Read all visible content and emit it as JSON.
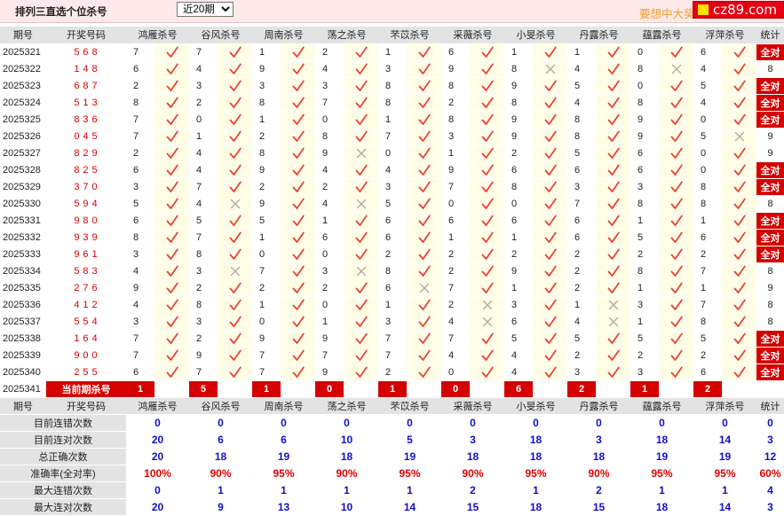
{
  "header": {
    "title": "排列三直选个位杀号",
    "period_select": "近20期",
    "slogan": "要想中大奖",
    "logo_text": "cz89.com"
  },
  "columns": {
    "period": "期号",
    "draw": "开奖号码",
    "experts": [
      "鸿雁杀号",
      "谷风杀号",
      "周南杀号",
      "荡之杀号",
      "芣苡杀号",
      "采薇杀号",
      "小旻杀号",
      "丹露杀号",
      "蕴露杀号",
      "浮萍杀号"
    ],
    "stat": "统计"
  },
  "rows": [
    {
      "period": "2025321",
      "draw": "568",
      "kills": [
        7,
        7,
        1,
        2,
        1,
        6,
        1,
        1,
        0,
        6
      ],
      "hits": [
        1,
        1,
        1,
        1,
        1,
        1,
        1,
        1,
        1,
        1
      ],
      "stat": "全对"
    },
    {
      "period": "2025322",
      "draw": "148",
      "kills": [
        6,
        4,
        9,
        4,
        3,
        9,
        8,
        4,
        8,
        4
      ],
      "hits": [
        1,
        1,
        1,
        1,
        1,
        1,
        0,
        1,
        0,
        1
      ],
      "stat": "8"
    },
    {
      "period": "2025323",
      "draw": "687",
      "kills": [
        2,
        3,
        3,
        3,
        8,
        8,
        9,
        5,
        0,
        5
      ],
      "hits": [
        1,
        1,
        1,
        1,
        1,
        1,
        1,
        1,
        1,
        1
      ],
      "stat": "全对"
    },
    {
      "period": "2025324",
      "draw": "513",
      "kills": [
        8,
        2,
        8,
        7,
        8,
        2,
        8,
        4,
        8,
        4
      ],
      "hits": [
        1,
        1,
        1,
        1,
        1,
        1,
        1,
        1,
        1,
        1
      ],
      "stat": "全对"
    },
    {
      "period": "2025325",
      "draw": "836",
      "kills": [
        7,
        0,
        1,
        0,
        1,
        8,
        9,
        8,
        9,
        0
      ],
      "hits": [
        1,
        1,
        1,
        1,
        1,
        1,
        1,
        1,
        1,
        1
      ],
      "stat": "全对"
    },
    {
      "period": "2025326",
      "draw": "045",
      "kills": [
        7,
        1,
        2,
        8,
        7,
        3,
        9,
        8,
        9,
        5
      ],
      "hits": [
        1,
        1,
        1,
        1,
        1,
        1,
        1,
        1,
        1,
        0
      ],
      "stat": "9"
    },
    {
      "period": "2025327",
      "draw": "829",
      "kills": [
        2,
        4,
        8,
        9,
        0,
        1,
        2,
        5,
        6,
        0
      ],
      "hits": [
        1,
        1,
        1,
        0,
        1,
        1,
        1,
        1,
        1,
        1
      ],
      "stat": "9"
    },
    {
      "period": "2025328",
      "draw": "825",
      "kills": [
        6,
        4,
        9,
        4,
        4,
        9,
        6,
        6,
        6,
        0
      ],
      "hits": [
        1,
        1,
        1,
        1,
        1,
        1,
        1,
        1,
        1,
        1
      ],
      "stat": "全对"
    },
    {
      "period": "2025329",
      "draw": "370",
      "kills": [
        3,
        7,
        2,
        2,
        3,
        7,
        8,
        3,
        3,
        8
      ],
      "hits": [
        1,
        1,
        1,
        1,
        1,
        1,
        1,
        1,
        1,
        1
      ],
      "stat": "全对"
    },
    {
      "period": "2025330",
      "draw": "594",
      "kills": [
        5,
        4,
        9,
        4,
        5,
        0,
        0,
        7,
        8,
        8
      ],
      "hits": [
        1,
        0,
        1,
        0,
        1,
        1,
        1,
        1,
        1,
        1
      ],
      "stat": "8"
    },
    {
      "period": "2025331",
      "draw": "980",
      "kills": [
        6,
        5,
        5,
        1,
        6,
        6,
        6,
        6,
        1,
        1
      ],
      "hits": [
        1,
        1,
        1,
        1,
        1,
        1,
        1,
        1,
        1,
        1
      ],
      "stat": "全对"
    },
    {
      "period": "2025332",
      "draw": "939",
      "kills": [
        8,
        7,
        1,
        6,
        6,
        1,
        1,
        6,
        5,
        6
      ],
      "hits": [
        1,
        1,
        1,
        1,
        1,
        1,
        1,
        1,
        1,
        1
      ],
      "stat": "全对"
    },
    {
      "period": "2025333",
      "draw": "961",
      "kills": [
        3,
        8,
        0,
        0,
        2,
        2,
        2,
        2,
        2,
        2
      ],
      "hits": [
        1,
        1,
        1,
        1,
        1,
        1,
        1,
        1,
        1,
        1
      ],
      "stat": "全对"
    },
    {
      "period": "2025334",
      "draw": "583",
      "kills": [
        4,
        3,
        7,
        3,
        8,
        2,
        9,
        2,
        8,
        7
      ],
      "hits": [
        1,
        0,
        1,
        0,
        1,
        1,
        1,
        1,
        1,
        1
      ],
      "stat": "8"
    },
    {
      "period": "2025335",
      "draw": "276",
      "kills": [
        9,
        2,
        2,
        2,
        6,
        7,
        1,
        2,
        1,
        1
      ],
      "hits": [
        1,
        1,
        1,
        1,
        0,
        1,
        1,
        1,
        1,
        1
      ],
      "stat": "9"
    },
    {
      "period": "2025336",
      "draw": "412",
      "kills": [
        4,
        8,
        1,
        0,
        1,
        2,
        3,
        1,
        3,
        7
      ],
      "hits": [
        1,
        1,
        1,
        1,
        1,
        0,
        1,
        0,
        1,
        1
      ],
      "stat": "8"
    },
    {
      "period": "2025337",
      "draw": "554",
      "kills": [
        3,
        3,
        0,
        1,
        3,
        4,
        6,
        4,
        1,
        8
      ],
      "hits": [
        1,
        1,
        1,
        1,
        1,
        0,
        1,
        0,
        1,
        1
      ],
      "stat": "8"
    },
    {
      "period": "2025338",
      "draw": "164",
      "kills": [
        7,
        2,
        9,
        9,
        7,
        7,
        5,
        5,
        5,
        5
      ],
      "hits": [
        1,
        1,
        1,
        1,
        1,
        1,
        1,
        1,
        1,
        1
      ],
      "stat": "全对"
    },
    {
      "period": "2025339",
      "draw": "900",
      "kills": [
        7,
        9,
        7,
        7,
        7,
        4,
        4,
        2,
        2,
        2
      ],
      "hits": [
        1,
        1,
        1,
        1,
        1,
        1,
        1,
        1,
        1,
        1
      ],
      "stat": "全对"
    },
    {
      "period": "2025340",
      "draw": "255",
      "kills": [
        6,
        7,
        7,
        9,
        2,
        0,
        4,
        3,
        3,
        6
      ],
      "hits": [
        1,
        1,
        1,
        1,
        1,
        1,
        1,
        1,
        1,
        1
      ],
      "stat": "全对"
    }
  ],
  "current": {
    "period": "2025341",
    "label": "当前期杀号",
    "kills": [
      "1",
      "5",
      "1",
      "0",
      "1",
      "0",
      "6",
      "2",
      "1",
      "2"
    ]
  },
  "summary": [
    {
      "label": "目前连错次数",
      "values": [
        "0",
        "0",
        "0",
        "0",
        "0",
        "0",
        "0",
        "0",
        "0",
        "0"
      ],
      "stat": "0",
      "color": "blue"
    },
    {
      "label": "目前连对次数",
      "values": [
        "20",
        "6",
        "6",
        "10",
        "5",
        "3",
        "18",
        "3",
        "18",
        "14"
      ],
      "stat": "3",
      "color": "blue"
    },
    {
      "label": "总正确次数",
      "values": [
        "20",
        "18",
        "19",
        "18",
        "19",
        "18",
        "18",
        "18",
        "19",
        "19"
      ],
      "stat": "12",
      "color": "blue"
    },
    {
      "label": "准确率(全对率)",
      "values": [
        "100%",
        "90%",
        "95%",
        "90%",
        "95%",
        "90%",
        "95%",
        "90%",
        "95%",
        "95%"
      ],
      "stat": "60%",
      "color": "red"
    },
    {
      "label": "最大连错次数",
      "values": [
        "0",
        "1",
        "1",
        "1",
        "1",
        "2",
        "1",
        "2",
        "1",
        "1"
      ],
      "stat": "4",
      "color": "blue"
    },
    {
      "label": "最大连对次数",
      "values": [
        "20",
        "9",
        "13",
        "10",
        "14",
        "15",
        "18",
        "15",
        "18",
        "14"
      ],
      "stat": "3",
      "color": "blue"
    }
  ],
  "colors": {
    "hit": "#e8413a",
    "miss": "#aaaaaa",
    "full": "#d50000",
    "sum_blue": "#1010c8",
    "sum_red": "#e00000"
  },
  "icons": {
    "hit": "check-icon",
    "miss": "cross-icon"
  }
}
